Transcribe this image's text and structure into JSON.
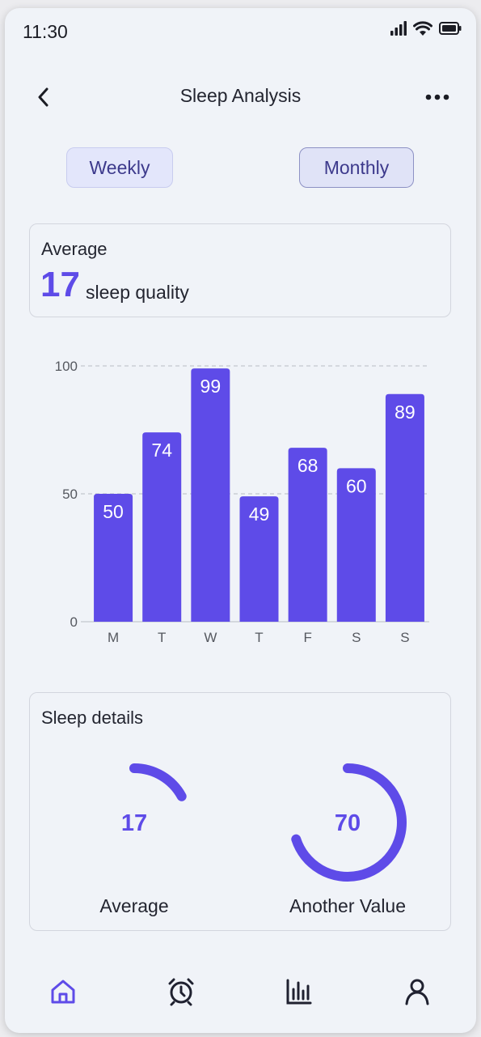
{
  "status": {
    "time": "11:30"
  },
  "header": {
    "title": "Sleep Analysis"
  },
  "toggles": {
    "weekly": "Weekly",
    "monthly": "Monthly"
  },
  "average_card": {
    "label": "Average",
    "value": "17",
    "unit": "sleep quality"
  },
  "chart_data": {
    "type": "bar",
    "categories": [
      "M",
      "T",
      "W",
      "T",
      "F",
      "S",
      "S"
    ],
    "values": [
      50,
      74,
      99,
      49,
      68,
      60,
      89
    ],
    "yticks": [
      0,
      50,
      100
    ],
    "ylim": [
      0,
      100
    ],
    "grid": true,
    "bar_color": "#5e4be8"
  },
  "details": {
    "title": "Sleep details",
    "gauges": [
      {
        "label": "Average",
        "value": "17",
        "fraction": 0.17
      },
      {
        "label": "Another Value",
        "value": "70",
        "fraction": 0.7
      }
    ]
  },
  "colors": {
    "accent": "#5e4be8",
    "background": "#f0f3f8",
    "active_tab": "#5e4be8",
    "inactive_tab": "#1f2130"
  },
  "tabs": [
    {
      "icon": "home-icon",
      "active": true
    },
    {
      "icon": "alarm-clock-icon",
      "active": false
    },
    {
      "icon": "bar-chart-icon",
      "active": false
    },
    {
      "icon": "user-icon",
      "active": false
    }
  ]
}
